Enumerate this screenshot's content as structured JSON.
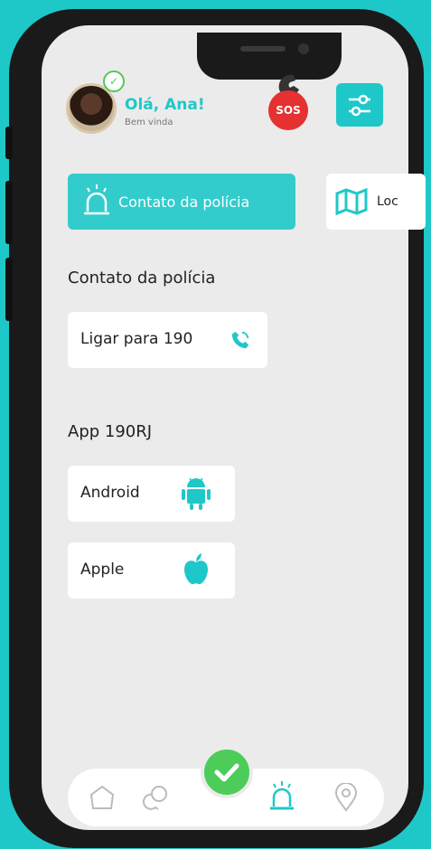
{
  "header": {
    "greeting": "Olá, Ana!",
    "subtitle": "Bem vinda",
    "sos_label": "SOS"
  },
  "tabs": [
    {
      "label": "Contato da polícia",
      "icon": "police-siren-icon",
      "active": true
    },
    {
      "label": "Loc",
      "icon": "map-icon",
      "active": false
    }
  ],
  "police": {
    "title": "Contato da polícia",
    "call_label": "Ligar para 190",
    "call_icon": "phone-icon"
  },
  "app": {
    "title": "App 190RJ",
    "android_label": "Android",
    "android_icon": "android-icon",
    "apple_label": "Apple",
    "apple_icon": "apple-icon"
  },
  "nav": {
    "items": [
      "home-icon",
      "chat-icon",
      "check-icon",
      "police-siren-icon",
      "location-pin-icon"
    ],
    "active": "police-siren-icon"
  },
  "colors": {
    "accent": "#1fc8c8",
    "sos": "#e53131",
    "success": "#4dcc5a",
    "background": "#ebebeb"
  }
}
